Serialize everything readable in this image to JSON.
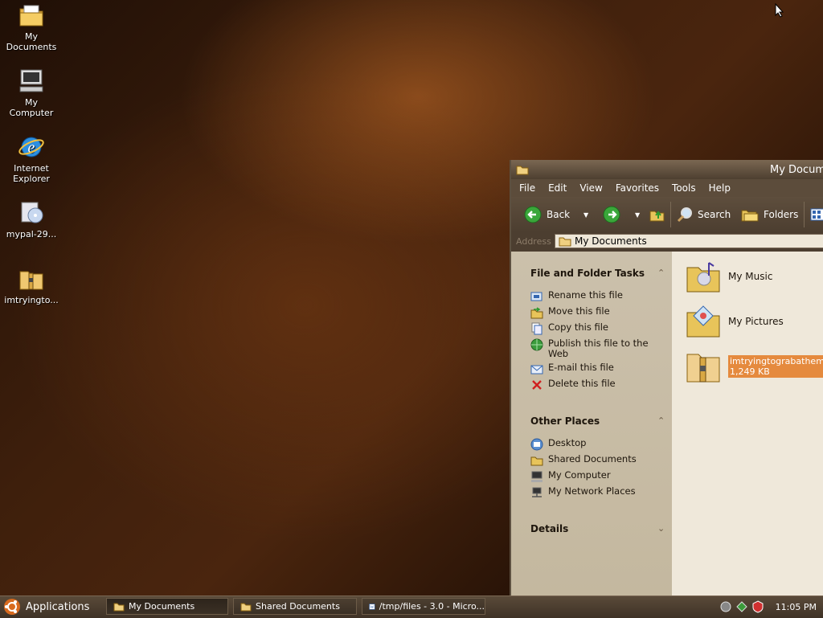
{
  "desktop": {
    "icons": [
      {
        "label": "My Documents",
        "icon": "folder-documents-icon"
      },
      {
        "label": "My Computer",
        "icon": "computer-icon"
      },
      {
        "label": "Internet Explorer",
        "icon": "internet-explorer-icon"
      },
      {
        "label": "mypal-29...",
        "icon": "installer-cd-icon"
      },
      {
        "label": "imtryingto...",
        "icon": "zip-archive-icon"
      }
    ]
  },
  "window": {
    "title": "My Docum",
    "menu": [
      "File",
      "Edit",
      "View",
      "Favorites",
      "Tools",
      "Help"
    ],
    "toolbar": {
      "back": "Back",
      "search": "Search",
      "folders": "Folders"
    },
    "address": {
      "label": "Address",
      "value": "My Documents"
    },
    "file_tasks": {
      "title": "File and Folder Tasks",
      "items": [
        "Rename this file",
        "Move this file",
        "Copy this file",
        "Publish this file to the Web",
        "E-mail this file",
        "Delete this file"
      ]
    },
    "other_places": {
      "title": "Other Places",
      "items": [
        "Desktop",
        "Shared Documents",
        "My Computer",
        "My Network Places"
      ]
    },
    "details": {
      "title": "Details"
    },
    "files": [
      {
        "name": "My Music",
        "size": ""
      },
      {
        "name": "My Pictures",
        "size": ""
      },
      {
        "name": "imtryingtograbathem",
        "size": "1,249 KB"
      }
    ]
  },
  "taskbar": {
    "apps_label": "Applications",
    "buttons": [
      "My Documents",
      "Shared Documents",
      "/tmp/files - 3.0 - Micro..."
    ],
    "clock": "11:05 PM"
  },
  "colors": {
    "selection": "#e58a3e",
    "task_pane": "#c8bca5",
    "toolbar": "#5c4c3b"
  }
}
